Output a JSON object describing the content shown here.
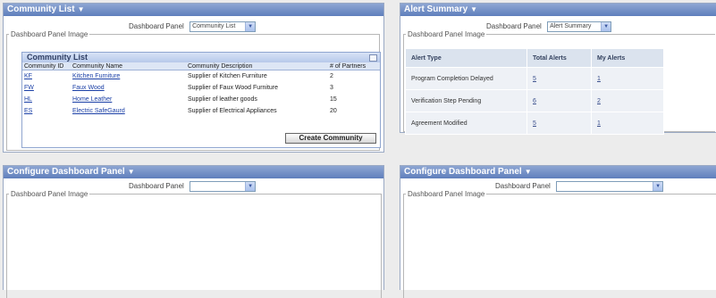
{
  "community_panel": {
    "title": "Community List",
    "caret": "▼",
    "dashboard_label": "Dashboard Panel",
    "selected": "Community List",
    "image_legend": "Dashboard Panel Image",
    "list_title": "Community List",
    "columns": [
      "Community ID",
      "Community Name",
      "Community Description",
      "# of Partners"
    ],
    "rows": [
      {
        "id": "KF",
        "name": "Kitchen Furniture",
        "desc": "Supplier of Kitchen Furniture",
        "partners": "2"
      },
      {
        "id": "FW",
        "name": "Faux Wood",
        "desc": "Supplier of Faux Wood Furniture",
        "partners": "3"
      },
      {
        "id": "HL",
        "name": "Home Leather",
        "desc": "Supplier of leather goods",
        "partners": "15"
      },
      {
        "id": "ES",
        "name": "Electric SafeGaurd",
        "desc": "Supplier of Electrical Appliances",
        "partners": "20"
      }
    ],
    "create_button": "Create Community"
  },
  "alert_panel": {
    "title": "Alert Summary",
    "caret": "▼",
    "dashboard_label": "Dashboard Panel",
    "selected": "Alert Summary",
    "image_legend": "Dashboard Panel Image",
    "columns": [
      "Alert Type",
      "Total Alerts",
      "My Alerts"
    ],
    "rows": [
      {
        "type": "Program Completion Delayed",
        "total": "5",
        "mine": "1"
      },
      {
        "type": "Verification Step Pending",
        "total": "6",
        "mine": "2"
      },
      {
        "type": "Agreement Modified",
        "total": "5",
        "mine": "1"
      }
    ]
  },
  "config_panel_left": {
    "title": "Configure Dashboard Panel",
    "caret": "▼",
    "dashboard_label": "Dashboard Panel",
    "selected": "",
    "image_legend": "Dashboard Panel Image"
  },
  "config_panel_right": {
    "title": "Configure Dashboard Panel",
    "caret": "▼",
    "dashboard_label": "Dashboard Panel",
    "selected": "",
    "image_legend": "Dashboard Panel Image"
  }
}
